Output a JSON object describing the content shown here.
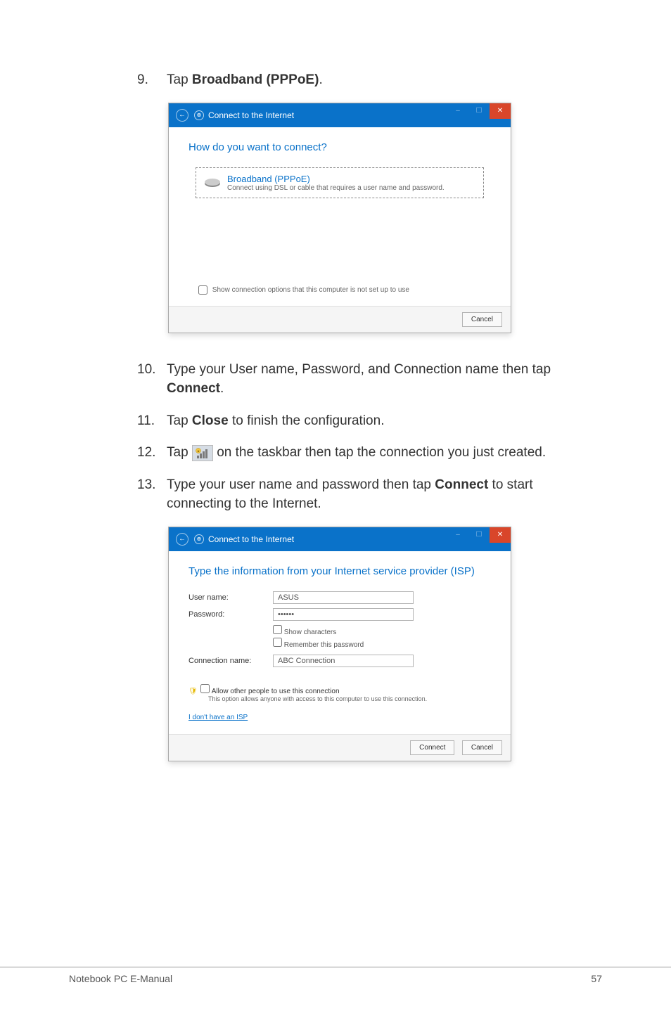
{
  "steps": {
    "s9": {
      "num": "9.",
      "prefix": "Tap ",
      "bold": "Broadband (PPPoE)",
      "suffix": "."
    },
    "s10": {
      "num": "10.",
      "text_a": "Type your User name, Password, and Connection name then tap ",
      "bold": "Connect",
      "text_b": "."
    },
    "s11": {
      "num": "11.",
      "text_a": "Tap ",
      "bold": "Close",
      "text_b": " to finish the configuration."
    },
    "s12": {
      "num": "12.",
      "text_a": "Tap ",
      "text_b": " on the taskbar then tap the connection you just created."
    },
    "s13": {
      "num": "13.",
      "text_a": "Type your user name and password then tap ",
      "bold": "Connect",
      "text_b": " to start connecting to the Internet."
    }
  },
  "dlg1": {
    "header_title": "Connect to the Internet",
    "heading": "How do you want to connect?",
    "option_title": "Broadband (PPPoE)",
    "option_desc": "Connect using DSL or cable that requires a user name and password.",
    "check": "Show connection options that this computer is not set up to use",
    "cancel": "Cancel"
  },
  "dlg2": {
    "header_title": "Connect to the Internet",
    "heading": "Type the information from your Internet service provider (ISP)",
    "user_label": "User name:",
    "user_value": "ASUS",
    "pass_label": "Password:",
    "pass_value": "••••••",
    "show_chars": "Show characters",
    "remember": "Remember this password",
    "conn_label": "Connection name:",
    "conn_value": "ABC Connection",
    "allow_label": "Allow other people to use this connection",
    "allow_desc": "This option allows anyone with access to this computer to use this connection.",
    "isp_link": "I don't have an ISP",
    "connect": "Connect",
    "cancel": "Cancel"
  },
  "footer": {
    "left": "Notebook PC E-Manual",
    "right": "57"
  }
}
